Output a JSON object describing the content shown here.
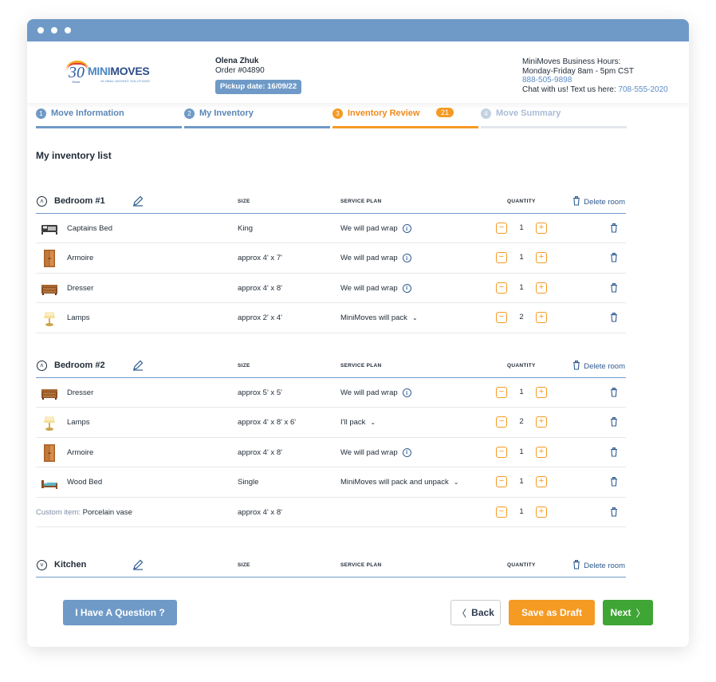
{
  "header": {
    "logo": {
      "number": "30",
      "years": "Years",
      "brand_a": "MINI",
      "brand_b": "MOVES",
      "tagline": "GLOBAL MOVING SOLUTIONS"
    },
    "client_name": "Olena Zhuk",
    "order": "Order #04890",
    "pickup": "Pickup date: 16/09/22",
    "hours_title": "MiniMoves Business Hours:",
    "hours": "Monday-Friday 8am - 5pm CST",
    "phone": "888-505-9898",
    "chat_label": "Chat with us! Text us here: ",
    "chat_phone": "708-555-2020"
  },
  "steps": [
    {
      "num": "1",
      "label": "Move Information"
    },
    {
      "num": "2",
      "label": "My Inventory"
    },
    {
      "num": "3",
      "label": "Inventory Review",
      "badge": "21"
    },
    {
      "num": "4",
      "label": "Move Summary"
    }
  ],
  "list_title": "My inventory list",
  "columns": {
    "size": "SIZE",
    "plan": "SERVICE PLAN",
    "quantity": "QUANTITY"
  },
  "delete_room_label": "Delete room",
  "rooms": [
    {
      "name": "Bedroom #1",
      "items": [
        {
          "name": "Captains Bed",
          "size": "King",
          "plan": "We will pad wrap",
          "qty": "1"
        },
        {
          "name": "Armoire",
          "size": "approx 4' x 7'",
          "plan": "We will pad wrap",
          "qty": "1"
        },
        {
          "name": "Dresser",
          "size": "approx 4' x 8'",
          "plan": "We will pad wrap",
          "qty": "1"
        },
        {
          "name": "Lamps",
          "size": "approx 2' x 4'",
          "plan": "MiniMoves will pack",
          "qty": "2"
        }
      ]
    },
    {
      "name": "Bedroom #2",
      "items": [
        {
          "name": "Dresser",
          "size": "approx 5' x 5'",
          "plan": "We will pad wrap",
          "qty": "1"
        },
        {
          "name": "Lamps",
          "size": "approx 4' x 8' x 6'",
          "plan": "I'll pack",
          "qty": "2"
        },
        {
          "name": "Armoire",
          "size": "approx 4' x 8'",
          "plan": "We will pad wrap",
          "qty": "1"
        },
        {
          "name": "Wood Bed",
          "size": "Single",
          "plan": "MiniMoves will pack and unpack",
          "qty": "1"
        },
        {
          "custom_label": "Custom item: ",
          "name": "Porcelain vase",
          "size": "approx 4' x 8'",
          "qty": "1"
        }
      ]
    },
    {
      "name": "Kitchen"
    }
  ],
  "buttons": {
    "question": "I Have A Question ?",
    "back": "Back",
    "draft": "Save as Draft",
    "next": "Next"
  },
  "colors": {
    "accent_blue": "#6f9ac7",
    "orange": "#f59a23",
    "green": "#3fa535"
  }
}
